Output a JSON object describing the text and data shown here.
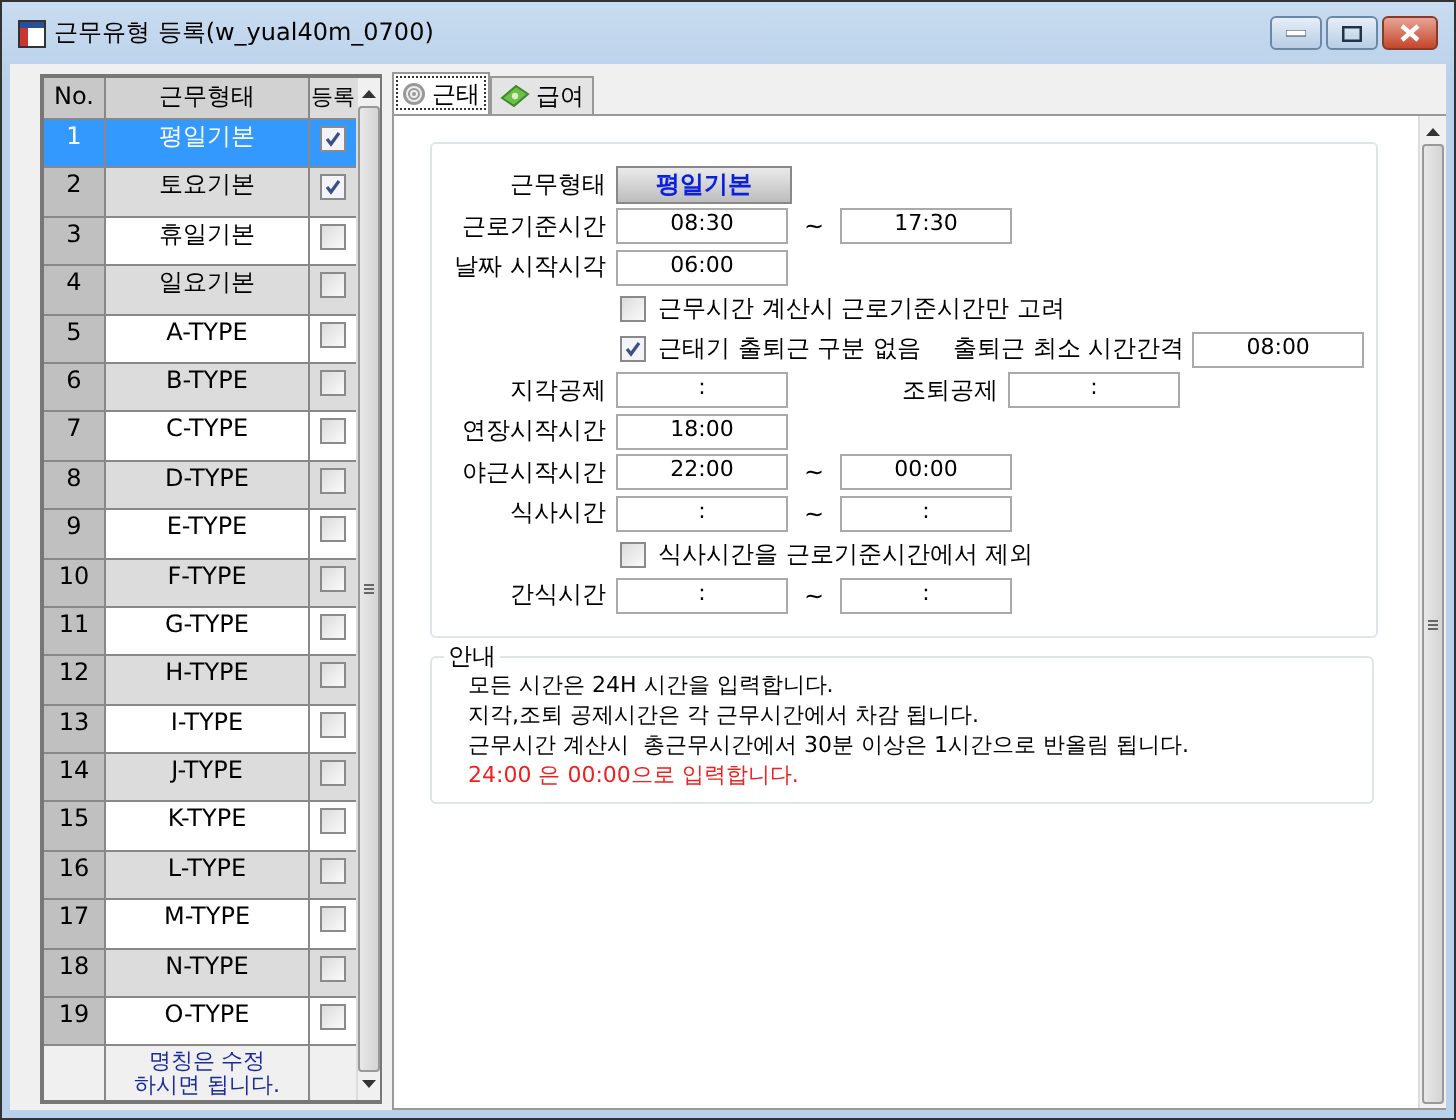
{
  "window": {
    "title": "근무유형 등록(w_yual40m_0700)"
  },
  "grid": {
    "columns": [
      "No.",
      "근무형태",
      "등록"
    ],
    "rows": [
      {
        "no": "1",
        "name": "평일기본",
        "registered": true,
        "selected": true
      },
      {
        "no": "2",
        "name": "토요기본",
        "registered": true,
        "selected": false
      },
      {
        "no": "3",
        "name": "휴일기본",
        "registered": false,
        "selected": false
      },
      {
        "no": "4",
        "name": "일요기본",
        "registered": false,
        "selected": false
      },
      {
        "no": "5",
        "name": "A-TYPE",
        "registered": false,
        "selected": false
      },
      {
        "no": "6",
        "name": "B-TYPE",
        "registered": false,
        "selected": false
      },
      {
        "no": "7",
        "name": "C-TYPE",
        "registered": false,
        "selected": false
      },
      {
        "no": "8",
        "name": "D-TYPE",
        "registered": false,
        "selected": false
      },
      {
        "no": "9",
        "name": "E-TYPE",
        "registered": false,
        "selected": false
      },
      {
        "no": "10",
        "name": "F-TYPE",
        "registered": false,
        "selected": false
      },
      {
        "no": "11",
        "name": "G-TYPE",
        "registered": false,
        "selected": false
      },
      {
        "no": "12",
        "name": "H-TYPE",
        "registered": false,
        "selected": false
      },
      {
        "no": "13",
        "name": "I-TYPE",
        "registered": false,
        "selected": false
      },
      {
        "no": "14",
        "name": "J-TYPE",
        "registered": false,
        "selected": false
      },
      {
        "no": "15",
        "name": "K-TYPE",
        "registered": false,
        "selected": false
      },
      {
        "no": "16",
        "name": "L-TYPE",
        "registered": false,
        "selected": false
      },
      {
        "no": "17",
        "name": "M-TYPE",
        "registered": false,
        "selected": false
      },
      {
        "no": "18",
        "name": "N-TYPE",
        "registered": false,
        "selected": false
      },
      {
        "no": "19",
        "name": "O-TYPE",
        "registered": false,
        "selected": false
      }
    ],
    "footer": "명칭은 수정\n하시면 됩니다."
  },
  "tabs": [
    {
      "label": "근태",
      "kind": "fingerprint",
      "selected": true
    },
    {
      "label": "급여",
      "kind": "money",
      "selected": false
    }
  ],
  "form": [
    {
      "kind": "button",
      "label": "근무형태",
      "value": "평일기본"
    },
    {
      "kind": "range",
      "label": "근로기준시간",
      "from": "08:30",
      "sep": "~",
      "to": "17:30"
    },
    {
      "kind": "single",
      "label": "날짜 시작시각",
      "value": "06:00"
    },
    {
      "kind": "check",
      "label": "근무시간 계산시 근로기준시간만 고려",
      "checked": false
    },
    {
      "kind": "check",
      "label": "근태기 출퇴근 구분 없음",
      "checked": true,
      "extra": {
        "label": "출퇴근 최소 시간간격",
        "value": "08:00"
      }
    },
    {
      "kind": "single",
      "label": "지각공제",
      "value": ":",
      "extra": {
        "label": "조퇴공제",
        "value": ":"
      }
    },
    {
      "kind": "single",
      "label": "연장시작시간",
      "value": "18:00"
    },
    {
      "kind": "range",
      "label": "야근시작시간",
      "from": "22:00",
      "sep": "~",
      "to": "00:00"
    },
    {
      "kind": "range",
      "label": "식사시간",
      "from": ":",
      "sep": "~",
      "to": ":"
    },
    {
      "kind": "check",
      "label": "식사시간을 근로기준시간에서 제외",
      "checked": false
    },
    {
      "kind": "range",
      "label": "간식시간",
      "from": ":",
      "sep": "~",
      "to": ":"
    }
  ],
  "notice": {
    "title": "안내",
    "lines": [
      {
        "kind": "normal",
        "text": "모든 시간은 24H 시간을 입력합니다."
      },
      {
        "kind": "normal",
        "text": "지각,조퇴 공제시간은 각 근무시간에서 차감 됩니다."
      },
      {
        "kind": "normal",
        "text": "근무시간 계산시  총근무시간에서 30분 이상은 1시간으로 반올림 됩니다."
      },
      {
        "kind": "warning",
        "text": "24:00 은 00:00으로 입력합니다."
      }
    ]
  }
}
